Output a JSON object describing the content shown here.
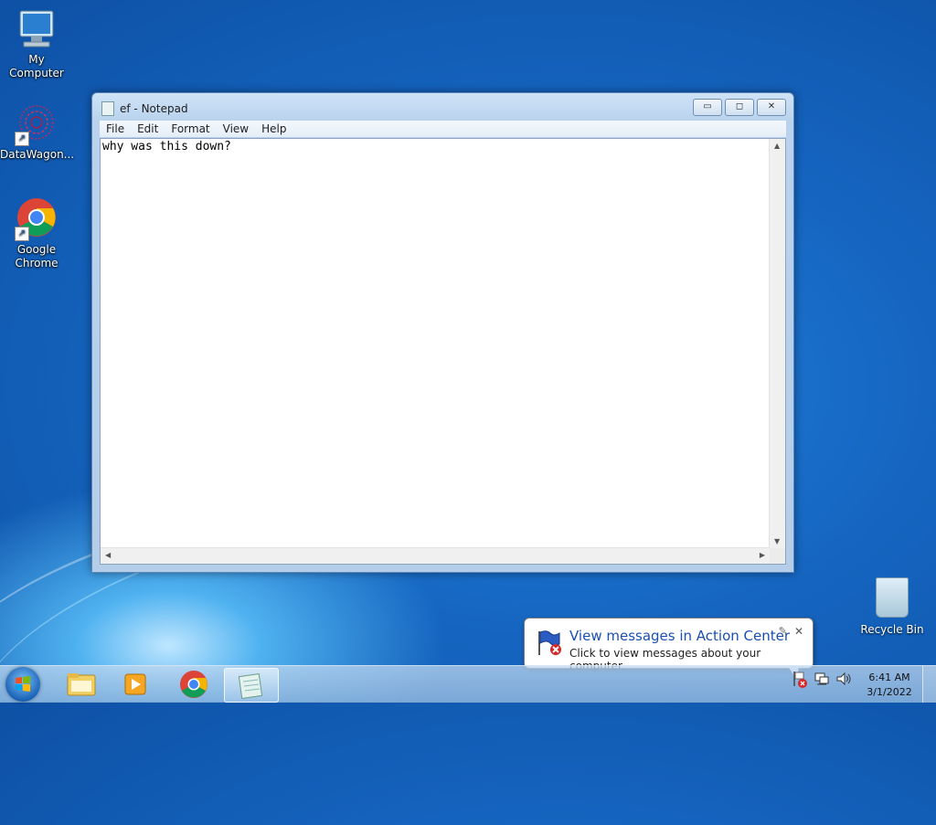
{
  "desktop": {
    "icons": [
      {
        "label": "My Computer"
      },
      {
        "label": "DataWagon..."
      },
      {
        "label": "Google Chrome"
      }
    ],
    "recycle_bin": {
      "label": "Recycle Bin"
    }
  },
  "window": {
    "title": "ef - Notepad",
    "buttons": {
      "minimize": "▭",
      "maximize": "◻",
      "close": "✕"
    },
    "menu": [
      "File",
      "Edit",
      "Format",
      "View",
      "Help"
    ],
    "content": "why was this down?"
  },
  "balloon": {
    "title": "View messages in Action Center",
    "text": "Click to view messages about your computer.",
    "close": "✕"
  },
  "taskbar": {
    "clock_time": "6:41 AM",
    "clock_date": "3/1/2022",
    "apps": [
      "windows-explorer",
      "windows-media-player",
      "google-chrome",
      "notepad"
    ]
  }
}
